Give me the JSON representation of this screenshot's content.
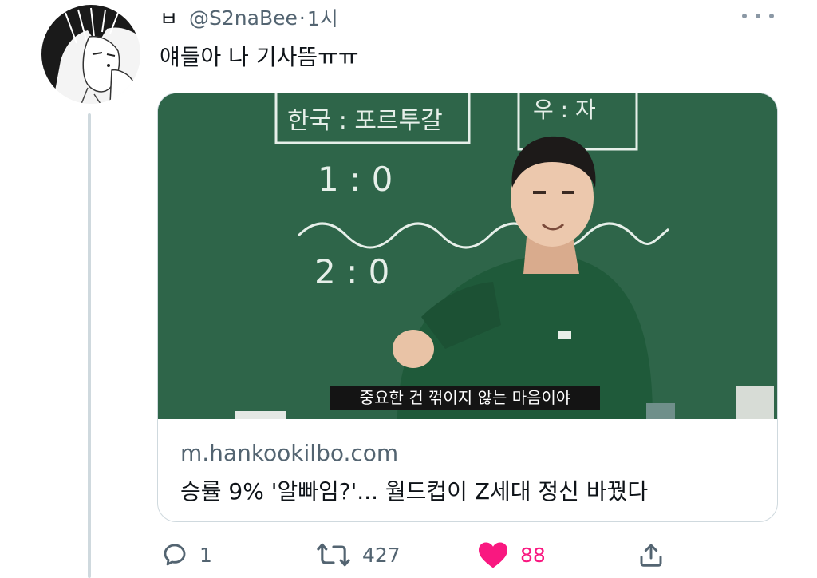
{
  "tweet": {
    "display_name": "ㅂ",
    "handle": "@S2naBee",
    "separator": "·",
    "time": "1시",
    "text": "얘들아 나 기사뜸ㅠㅠ"
  },
  "card": {
    "video_subtitle": "중요한 건 꺾이지 않는 마음이야",
    "board_texts": [
      "한국 : 포르투갈",
      "우 : 자",
      "1 : 0",
      "2 : 0"
    ],
    "domain": "m.hankookilbo.com",
    "title": "승률 9% '알빠임?'... 월드컵이 Z세대 정신 바꿨다"
  },
  "actions": {
    "reply": {
      "icon": "reply-icon",
      "count": "1"
    },
    "retweet": {
      "icon": "retweet-icon",
      "count": "427"
    },
    "like": {
      "icon": "heart-icon",
      "count": "88",
      "liked": true
    },
    "share": {
      "icon": "share-icon"
    }
  },
  "colors": {
    "text": "#0f1419",
    "secondary": "#536471",
    "border": "#cfd9de",
    "like": "#f91880",
    "chalkboard": "#2c6147"
  }
}
